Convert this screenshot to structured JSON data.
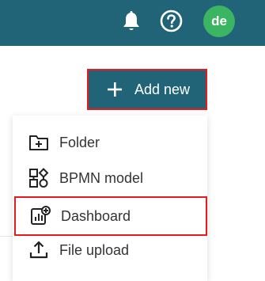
{
  "header": {
    "notifications_icon": "bell-icon",
    "help_icon": "question-circle-icon",
    "avatar_initials": "de",
    "background_color": "#216477",
    "avatar_color": "#3cb563"
  },
  "actions": {
    "add_new_label": "Add new",
    "add_new_icon": "plus-icon",
    "highlight_color": "#e81a1a"
  },
  "menu": {
    "items": [
      {
        "label": "Folder",
        "icon": "folder-plus-icon"
      },
      {
        "label": "BPMN model",
        "icon": "bpmn-diagram-icon"
      },
      {
        "label": "Dashboard",
        "icon": "dashboard-icon"
      },
      {
        "label": "File upload",
        "icon": "upload-icon"
      }
    ]
  }
}
